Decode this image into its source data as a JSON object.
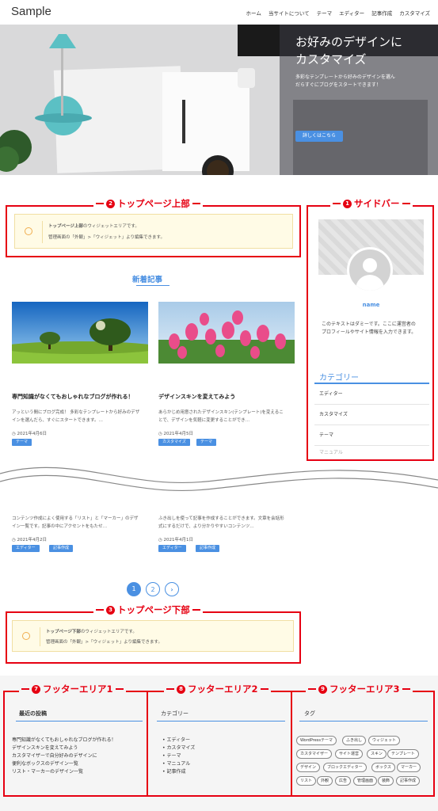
{
  "header": {
    "site_title": "Sample",
    "nav": [
      "ホーム",
      "当サイトについて",
      "テーマ",
      "エディター",
      "記事作成",
      "カスタマイズ"
    ]
  },
  "hero": {
    "title_line1": "お好みのデザインに",
    "title_line2": "カスタマイズ",
    "text_line1": "多彩なテンプレートから好みのデザインを選ん",
    "text_line2": "だらすぐにブログをスタートできます！",
    "button": "詳しくはこちら"
  },
  "annotations": {
    "top_upper": {
      "num": "2",
      "label": "トップページ上部"
    },
    "sidebar": {
      "num": "1",
      "label": "サイドバー"
    },
    "top_lower": {
      "num": "3",
      "label": "トップページ下部"
    },
    "footer1": {
      "num": "7",
      "label": "フッターエリア1"
    },
    "footer2": {
      "num": "8",
      "label": "フッターエリア2"
    },
    "footer3": {
      "num": "9",
      "label": "フッターエリア3"
    }
  },
  "top_widget": {
    "line1_bold": "トップページ上部",
    "line1_rest": "のウィジェットエリアです。",
    "line2": "管理画面の「外観」>「ウィジェット」より編集できます。"
  },
  "bottom_widget": {
    "line1_bold": "トップページ下部",
    "line1_rest": "のウィジェットエリアです。",
    "line2": "管理画面の「外観」>「ウィジェット」より編集できます。"
  },
  "new_posts": {
    "heading": "新着記事",
    "posts": [
      {
        "title": "専門知識がなくてもおしゃれなブログが作れる！",
        "excerpt1": "アッという間にブログ完成！ 多彩なテンプレートから好みのデザ",
        "excerpt2": "インを選んだら、すぐにスタートできます。…",
        "date": "◷ 2021年4月6日",
        "tags": [
          "テーマ"
        ]
      },
      {
        "title": "デザインスキンを変えてみよう",
        "excerpt1": "あらかじめ用意されたデザインスキン(テンプレート)を変えるこ",
        "excerpt2": "とで、デザインを気軽に変更することができ…",
        "date": "◷ 2021年4月5日",
        "tags": [
          "カスタマイズ",
          "テーマ"
        ]
      },
      {
        "title": "",
        "excerpt1": "コンテンツ作成によく使用する「リスト」と「マーカー」のデザ",
        "excerpt2": "イン一覧です。記事の中にアクセントをもたせ…",
        "date": "◷ 2021年4月2日",
        "tags": [
          "エディター",
          "記事作成"
        ]
      },
      {
        "title": "",
        "excerpt1": "ふき出しを使って記事を作成することができます。文章を会話形",
        "excerpt2": "式にするだけで、より分かりやすいコンテンツ…",
        "date": "◷ 2021年4月1日",
        "tags": [
          "エディター",
          "記事作成"
        ]
      }
    ]
  },
  "pagination": {
    "pages": [
      "1",
      "2"
    ],
    "next": "›"
  },
  "sidebar": {
    "profile_name": "name",
    "profile_text1": "このテキストはダミーです。ここに運営者の",
    "profile_text2": "プロフィールやサイト情報を入力できます。",
    "category_heading": "カテゴリー",
    "categories": [
      "エディター",
      "カスタマイズ",
      "テーマ",
      "マニュアル"
    ]
  },
  "footer": {
    "col1": {
      "heading": "最近の投稿",
      "items": [
        "専門知識がなくてもおしゃれなブログが作れる！",
        "デザインスキンを変えてみよう",
        "カスタマイザーで自分好みのデザインに",
        "便利なボックスのデザイン一覧",
        "リスト・マーカーのデザイン一覧"
      ]
    },
    "col2": {
      "heading": "カテゴリー",
      "items": [
        "エディター",
        "カスタマイズ",
        "テーマ",
        "マニュアル",
        "記事作成"
      ]
    },
    "col3": {
      "heading": "タグ",
      "tags": [
        "WordPressテーマ",
        "ふき出し",
        "ウィジェット",
        "カスタマイザー",
        "サイト運営",
        "スキン",
        "テンプレート",
        "デザイン",
        "ブロックエディター",
        "ボックス",
        "マーカー",
        "リスト",
        "外観",
        "広告",
        "管理画面",
        "装飾",
        "記事作成"
      ]
    }
  },
  "colors": {
    "accent": "#4a90e2",
    "annotation_red": "#e60012",
    "note_bg": "#fffbe6"
  }
}
